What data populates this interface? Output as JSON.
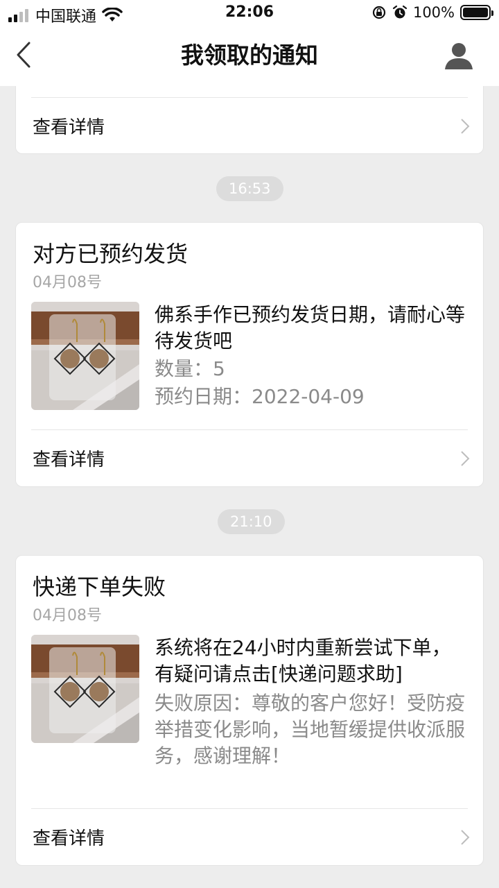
{
  "status_bar": {
    "carrier": "中国联通",
    "time": "22:06",
    "battery": "100%",
    "signal_bars": "2 of 4"
  },
  "nav": {
    "back_icon": "chevron-left-icon",
    "title": "我领取的通知",
    "user_icon": "user-icon"
  },
  "notifications": [
    {
      "detail_label": "查看详情"
    },
    {
      "time_divider": "16:53",
      "title": "对方已预约发货",
      "date": "04月08号",
      "message_main": "佛系手作已预约发货日期，请耐心等待发货吧",
      "lines": [
        "数量：5",
        "预约日期：2022-04-09"
      ],
      "detail_label": "查看详情"
    },
    {
      "time_divider": "21:10",
      "title": "快递下单失败",
      "date": "04月08号",
      "message_main": "系统将在24小时内重新尝试下单，有疑问请点击[快递问题求助]",
      "message_sub": "失败原因：尊敬的客户您好！受防疫举措变化影响，当地暂缓提供收派服务，感谢理解！",
      "detail_label": "查看详情"
    }
  ],
  "colors": {
    "page_bg": "#ededed",
    "card_bg": "#ffffff",
    "time_pill_bg": "#dcdcdc",
    "muted_text": "#8a8a8a"
  }
}
